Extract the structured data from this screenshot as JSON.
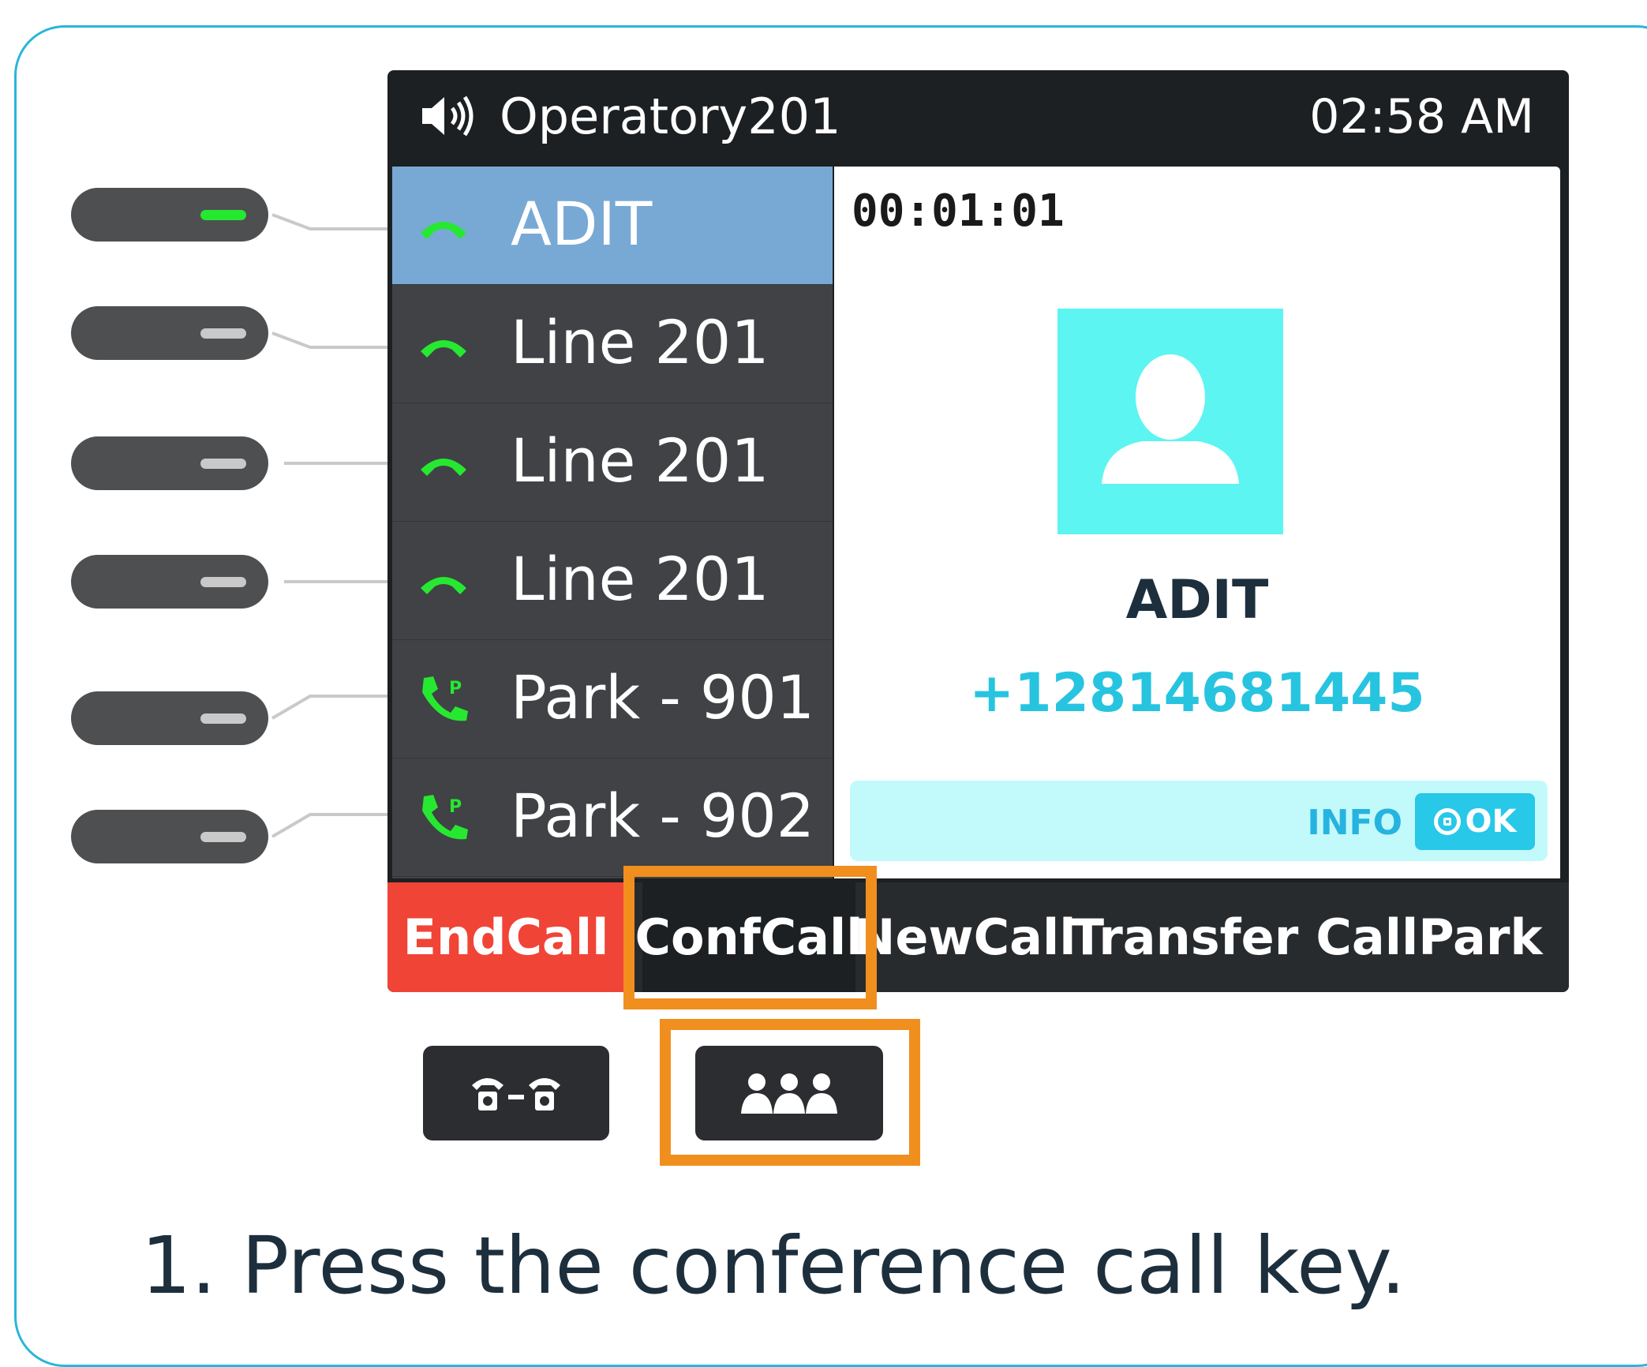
{
  "status_bar": {
    "title": "Operatory201",
    "time": "02:58 AM",
    "speaker_icon": "speaker-volume-icon"
  },
  "lines": [
    {
      "label": "ADIT",
      "icon": "handset-icon",
      "selected": true
    },
    {
      "label": "Line 201",
      "icon": "handset-icon",
      "selected": false
    },
    {
      "label": "Line 201",
      "icon": "handset-icon",
      "selected": false
    },
    {
      "label": "Line 201",
      "icon": "handset-icon",
      "selected": false
    },
    {
      "label": "Park - 901",
      "icon": "park-phone-icon",
      "selected": false
    },
    {
      "label": "Park - 902",
      "icon": "park-phone-icon",
      "selected": false
    }
  ],
  "call": {
    "timer": "00:01:01",
    "contact_name": "ADIT",
    "contact_number": "+12814681445",
    "info_label": "INFO",
    "ok_label": "OK"
  },
  "softkeys": {
    "end_call": "EndCall",
    "conf_call": "ConfCall",
    "new_call": "NewCall",
    "transfer": "Transfer",
    "call_park": "CallPark"
  },
  "hard_keys": [
    "transfer-key-icon",
    "conference-key-icon"
  ],
  "caption": "1. Press the conference call key.",
  "colors": {
    "accent": "#29b6d9",
    "highlight": "#f08f1e",
    "end_call": "#f04437",
    "line_active_led": "#26e830",
    "selected_row": "#78a9d4",
    "avatar": "#5cf5f1"
  }
}
